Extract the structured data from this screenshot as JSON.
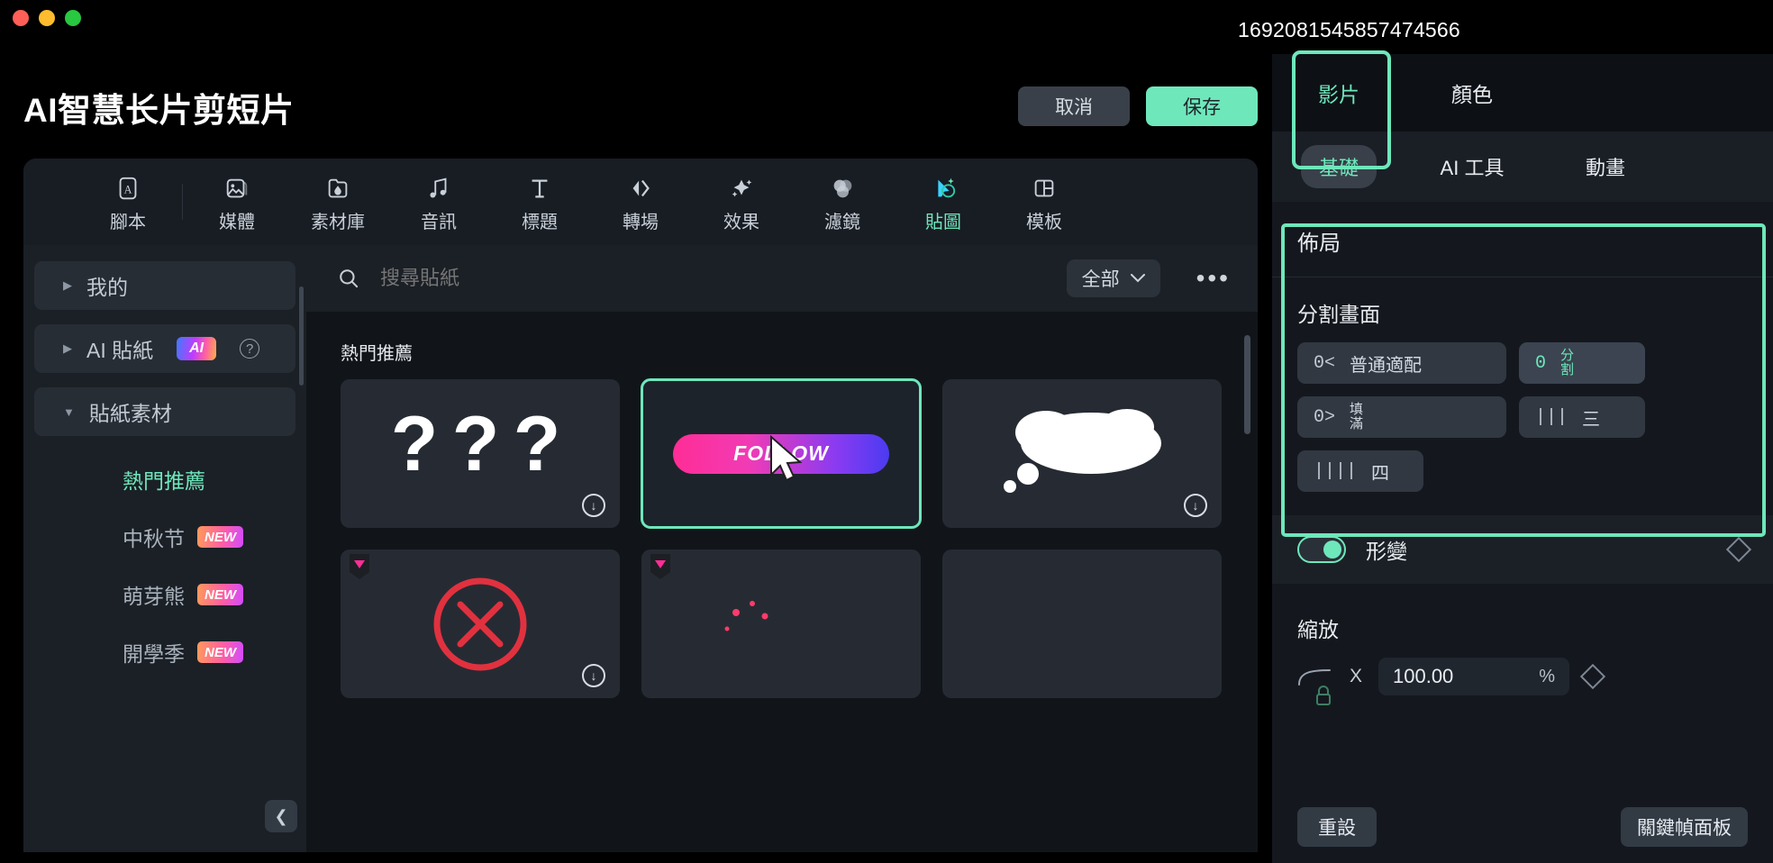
{
  "window": {
    "timestamp": "1692081545857474566",
    "title": "AI智慧长片剪短片",
    "traffic": {
      "close": "close-button",
      "minimize": "minimize-button",
      "zoom": "zoom-button"
    }
  },
  "header": {
    "cancel_label": "取消",
    "save_label": "保存"
  },
  "toolbar": {
    "items": [
      {
        "label": "腳本",
        "icon": "script-icon"
      },
      {
        "label": "媒體",
        "icon": "media-icon"
      },
      {
        "label": "素材庫",
        "icon": "asset-library-icon"
      },
      {
        "label": "音訊",
        "icon": "audio-icon"
      },
      {
        "label": "標題",
        "icon": "title-icon"
      },
      {
        "label": "轉場",
        "icon": "transition-icon"
      },
      {
        "label": "效果",
        "icon": "effect-icon"
      },
      {
        "label": "濾鏡",
        "icon": "filter-icon"
      },
      {
        "label": "貼圖",
        "icon": "sticker-icon"
      },
      {
        "label": "模板",
        "icon": "template-icon"
      }
    ],
    "active_index": 8
  },
  "sidebar": {
    "groups": [
      {
        "label": "我的",
        "expanded": false,
        "badge": ""
      },
      {
        "label": "AI 貼紙",
        "expanded": false,
        "badge": "AI",
        "help": "?"
      },
      {
        "label": "貼紙素材",
        "expanded": true,
        "badge": ""
      }
    ],
    "items": [
      {
        "label": "熱門推薦",
        "badge": "",
        "active": true
      },
      {
        "label": "中秋节",
        "badge": "NEW",
        "active": false
      },
      {
        "label": "萌芽熊",
        "badge": "NEW",
        "active": false
      },
      {
        "label": "開學季",
        "badge": "NEW",
        "active": false
      }
    ],
    "collapse_icon": "chevron-left-icon"
  },
  "content": {
    "search_placeholder": "搜尋貼紙",
    "search_value": "",
    "filter_label": "全部",
    "more_label": "•••",
    "section_title": "熱門推薦",
    "cells": [
      {
        "name": "question-marks-sticker",
        "kind": "questions",
        "selected": false,
        "downloadable": true,
        "pro": false
      },
      {
        "name": "follow-button-sticker",
        "kind": "follow",
        "label": "FOLLOW",
        "selected": true,
        "downloadable": false,
        "pro": false
      },
      {
        "name": "thought-cloud-sticker",
        "kind": "cloud",
        "selected": false,
        "downloadable": true,
        "pro": false
      },
      {
        "name": "red-cross-sticker",
        "kind": "cross",
        "selected": false,
        "downloadable": true,
        "pro": true
      },
      {
        "name": "sparkle-sticker",
        "kind": "sparkle",
        "selected": false,
        "downloadable": false,
        "pro": true
      },
      {
        "name": "blank-sticker",
        "kind": "blank",
        "selected": false,
        "downloadable": false,
        "pro": false
      }
    ]
  },
  "properties": {
    "tabs": [
      {
        "label": "影片",
        "active": true
      },
      {
        "label": "顏色",
        "active": false
      }
    ],
    "subtabs": [
      {
        "label": "基礎",
        "active": true
      },
      {
        "label": "AI 工具",
        "active": false
      },
      {
        "label": "動畫",
        "active": false
      }
    ],
    "layout_section": {
      "title": "佈局",
      "split_title": "分割畫面",
      "options": [
        {
          "glyph": "0<",
          "label": "普通適配",
          "size": "lg",
          "active": false
        },
        {
          "glyph": "0",
          "label": "分割",
          "size": "sm",
          "active": true,
          "two_line": true
        },
        {
          "glyph": "0>",
          "label": "填滿",
          "size": "lg",
          "active": false,
          "two_line": true
        },
        {
          "glyph": "|||",
          "label": "三",
          "size": "sm",
          "active": false
        },
        {
          "glyph": "||||",
          "label": "四",
          "size": "sm",
          "active": false
        }
      ]
    },
    "shape_row": {
      "label": "形變",
      "toggle_on": true,
      "keyframe_icon": "diamond-keyframe-icon"
    },
    "scale": {
      "label": "縮放",
      "axis": "X",
      "value": "100.00",
      "unit": "%",
      "lock_icon": "lock-icon",
      "curve_icon": "curve-icon",
      "keyframe_icon": "diamond-keyframe-icon"
    },
    "reset_label": "重設",
    "keyframe_panel_label": "關鍵幀面板"
  },
  "colors": {
    "accent": "#6ee7bb",
    "panel_bg": "#14181e",
    "dark_bg": "#0d1116",
    "chip_bg": "#313842"
  }
}
